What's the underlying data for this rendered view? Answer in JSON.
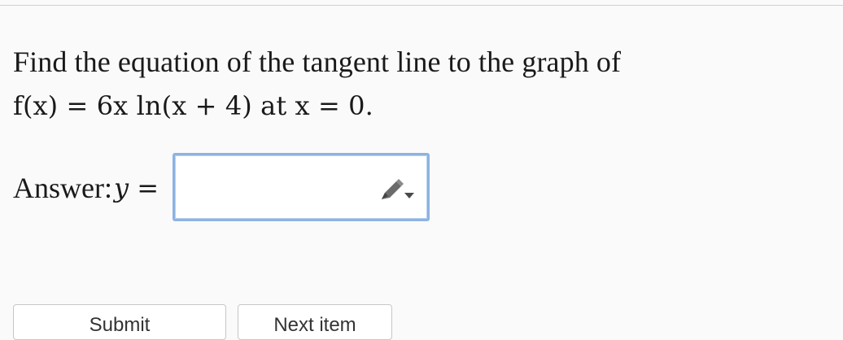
{
  "question": {
    "line1": "Find the equation of the tangent line to the graph of",
    "line2": "f(x) = 6x ln(x + 4) at x = 0."
  },
  "answer": {
    "label": "Answer:",
    "math": "y =",
    "input_value": "",
    "input_placeholder": ""
  },
  "icons": {
    "editor": "pencil-icon"
  },
  "buttons": {
    "submit_label": "Submit",
    "next_label": "Next item"
  },
  "colors": {
    "input_border": "#8db3e2",
    "page_background": "#fafafa"
  }
}
